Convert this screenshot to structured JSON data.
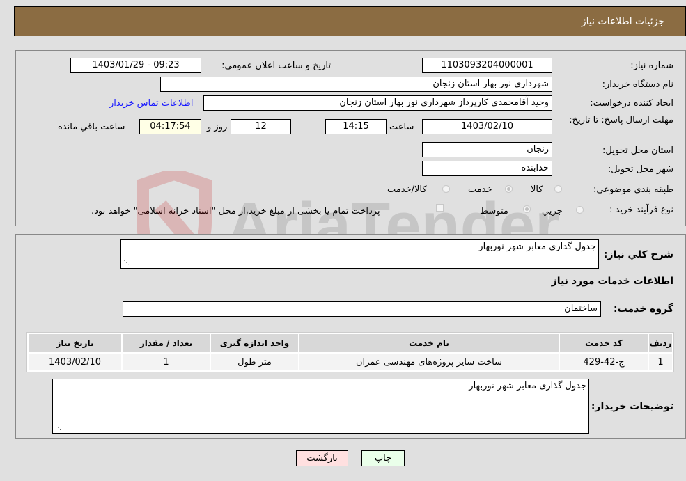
{
  "header": {
    "title": "جزئیات اطلاعات نیاز"
  },
  "form": {
    "need_number": {
      "label": "شماره نیاز:",
      "value": "1103093204000001"
    },
    "announce_datetime": {
      "label": "تاریخ و ساعت اعلان عمومي:",
      "value": "1403/01/29 - 09:23"
    },
    "buyer_org": {
      "label": "نام دستگاه خريدار:",
      "value": "شهرداری نور بهار استان زنجان"
    },
    "requester": {
      "label": "ايجاد کننده درخواست:",
      "value": "وحید آقامحمدی کارپرداز شهرداری نور بهار استان زنجان"
    },
    "buyer_contact_link": "اطلاعات تماس خريدار",
    "deadline": {
      "label": "مهلت ارسال پاسخ: تا تاریخ:",
      "date": "1403/02/10",
      "time_label": "ساعت",
      "time": "14:15",
      "days": "12",
      "days_label": "روز و",
      "remaining": "04:17:54",
      "remaining_label": "ساعت باقي مانده"
    },
    "delivery_province": {
      "label": "استان محل تحویل:",
      "value": "زنجان"
    },
    "delivery_city": {
      "label": "شهر محل تحویل:",
      "value": "خدابنده"
    },
    "category": {
      "label": "طبقه بندی موضوعی:",
      "options": [
        "کالا",
        "خدمت",
        "کالا/خدمت"
      ],
      "selected": "خدمت"
    },
    "purchase_process": {
      "label": "نوع فرآیند خرید :",
      "options": [
        "جزيي",
        "متوسط"
      ],
      "selected": "متوسط",
      "treasury_note": "پرداخت تمام يا بخشی از مبلغ خرید،از محل \"اسناد خزانه اسلامی\" خواهد بود."
    }
  },
  "details": {
    "summary_label": "شرح كلي نياز:",
    "summary_value": "جدول گذاری معابر شهر نوربهار",
    "services_heading": "اطلاعات خدمات مورد نياز",
    "service_group_label": "گروه خدمت:",
    "service_group_value": "ساختمان",
    "table": {
      "headers": [
        "رديف",
        "کد خدمت",
        "نام خدمت",
        "واحد اندازه گيری",
        "تعداد / مقدار",
        "تاريخ نياز"
      ],
      "rows": [
        [
          "1",
          "ج-42-429",
          "ساخت سایر پروژه‌های مهندسی عمران",
          "متر طول",
          "1",
          "1403/02/10"
        ]
      ]
    },
    "buyer_notes_label": "توضيحات خريدار:",
    "buyer_notes_value": "جدول گذاری معابر شهر نوربهار"
  },
  "buttons": {
    "print": "چاپ",
    "back": "بازگشت"
  },
  "watermark": "AriaTender.neT",
  "colors": {
    "header": "#8b6c42",
    "print_bg": "#eaffea",
    "back_bg": "#ffe0e0",
    "link": "#1a1aff"
  }
}
